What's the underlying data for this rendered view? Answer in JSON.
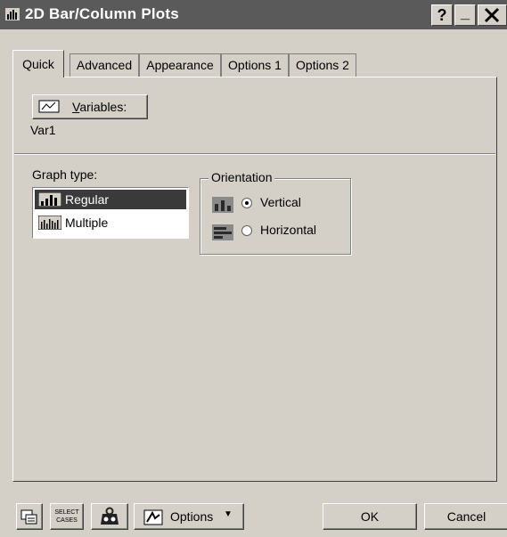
{
  "window": {
    "title": "2D Bar/Column Plots",
    "help_label": "?",
    "minimize_label": "_",
    "close_label": "X"
  },
  "tabs": [
    {
      "label": "Quick",
      "active": true
    },
    {
      "label": "Advanced",
      "active": false
    },
    {
      "label": "Appearance",
      "active": false
    },
    {
      "label": "Options 1",
      "active": false
    },
    {
      "label": "Options 2",
      "active": false
    }
  ],
  "variables": {
    "button_label": "Variables:",
    "value": "Var1"
  },
  "graph_type": {
    "label": "Graph type:",
    "items": [
      {
        "label": "Regular",
        "selected": true
      },
      {
        "label": "Multiple",
        "selected": false
      }
    ]
  },
  "orientation": {
    "label": "Orientation",
    "options": [
      {
        "label": "Vertical",
        "selected": true
      },
      {
        "label": "Horizontal",
        "selected": false
      }
    ]
  },
  "footer": {
    "select_cases_line1": "SELECT",
    "select_cases_line2": "CASES",
    "options_label": "Options",
    "ok_label": "OK",
    "cancel_label": "Cancel"
  }
}
